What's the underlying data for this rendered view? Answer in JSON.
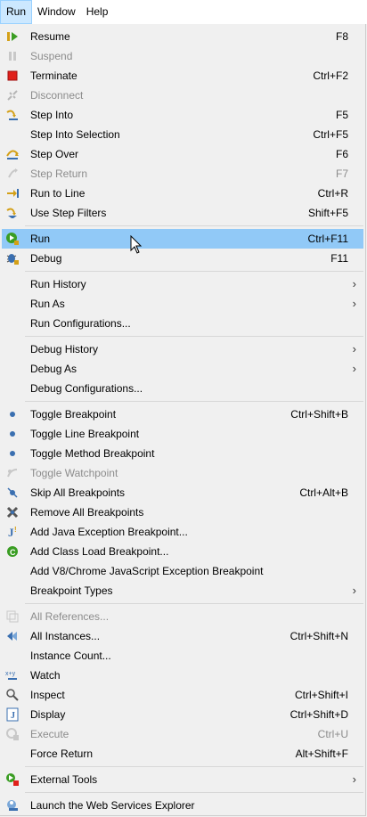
{
  "menubar": {
    "run": "Run",
    "window": "Window",
    "help": "Help"
  },
  "menu": {
    "resume": {
      "label": "Resume",
      "shortcut": "F8"
    },
    "suspend": {
      "label": "Suspend"
    },
    "terminate": {
      "label": "Terminate",
      "shortcut": "Ctrl+F2"
    },
    "disconnect": {
      "label": "Disconnect"
    },
    "step_into": {
      "label": "Step Into",
      "shortcut": "F5"
    },
    "step_into_selection": {
      "label": "Step Into Selection",
      "shortcut": "Ctrl+F5"
    },
    "step_over": {
      "label": "Step Over",
      "shortcut": "F6"
    },
    "step_return": {
      "label": "Step Return",
      "shortcut": "F7"
    },
    "run_to_line": {
      "label": "Run to Line",
      "shortcut": "Ctrl+R"
    },
    "use_step_filters": {
      "label": "Use Step Filters",
      "shortcut": "Shift+F5"
    },
    "run": {
      "label": "Run",
      "shortcut": "Ctrl+F11"
    },
    "debug": {
      "label": "Debug",
      "shortcut": "F11"
    },
    "run_history": {
      "label": "Run History"
    },
    "run_as": {
      "label": "Run As"
    },
    "run_configurations": {
      "label": "Run Configurations..."
    },
    "debug_history": {
      "label": "Debug History"
    },
    "debug_as": {
      "label": "Debug As"
    },
    "debug_configurations": {
      "label": "Debug Configurations..."
    },
    "toggle_breakpoint": {
      "label": "Toggle Breakpoint",
      "shortcut": "Ctrl+Shift+B"
    },
    "toggle_line_breakpoint": {
      "label": "Toggle Line Breakpoint"
    },
    "toggle_method_breakpoint": {
      "label": "Toggle Method Breakpoint"
    },
    "toggle_watchpoint": {
      "label": "Toggle Watchpoint"
    },
    "skip_all_breakpoints": {
      "label": "Skip All Breakpoints",
      "shortcut": "Ctrl+Alt+B"
    },
    "remove_all_breakpoints": {
      "label": "Remove All Breakpoints"
    },
    "add_java_exception_breakpoint": {
      "label": "Add Java Exception Breakpoint..."
    },
    "add_class_load_breakpoint": {
      "label": "Add Class Load Breakpoint..."
    },
    "add_v8_exception_breakpoint": {
      "label": "Add V8/Chrome JavaScript Exception Breakpoint"
    },
    "breakpoint_types": {
      "label": "Breakpoint Types"
    },
    "all_references": {
      "label": "All References..."
    },
    "all_instances": {
      "label": "All Instances...",
      "shortcut": "Ctrl+Shift+N"
    },
    "instance_count": {
      "label": "Instance Count..."
    },
    "watch": {
      "label": "Watch"
    },
    "inspect": {
      "label": "Inspect",
      "shortcut": "Ctrl+Shift+I"
    },
    "display": {
      "label": "Display",
      "shortcut": "Ctrl+Shift+D"
    },
    "execute": {
      "label": "Execute",
      "shortcut": "Ctrl+U"
    },
    "force_return": {
      "label": "Force Return",
      "shortcut": "Alt+Shift+F"
    },
    "external_tools": {
      "label": "External Tools"
    },
    "launch_web_services_explorer": {
      "label": "Launch the Web Services Explorer"
    }
  },
  "state": {
    "highlighted_item": "Run"
  },
  "colors": {
    "highlight": "#91c9f7",
    "menubar_active": "#cce8ff",
    "disabled_text": "#8c8c8c"
  }
}
